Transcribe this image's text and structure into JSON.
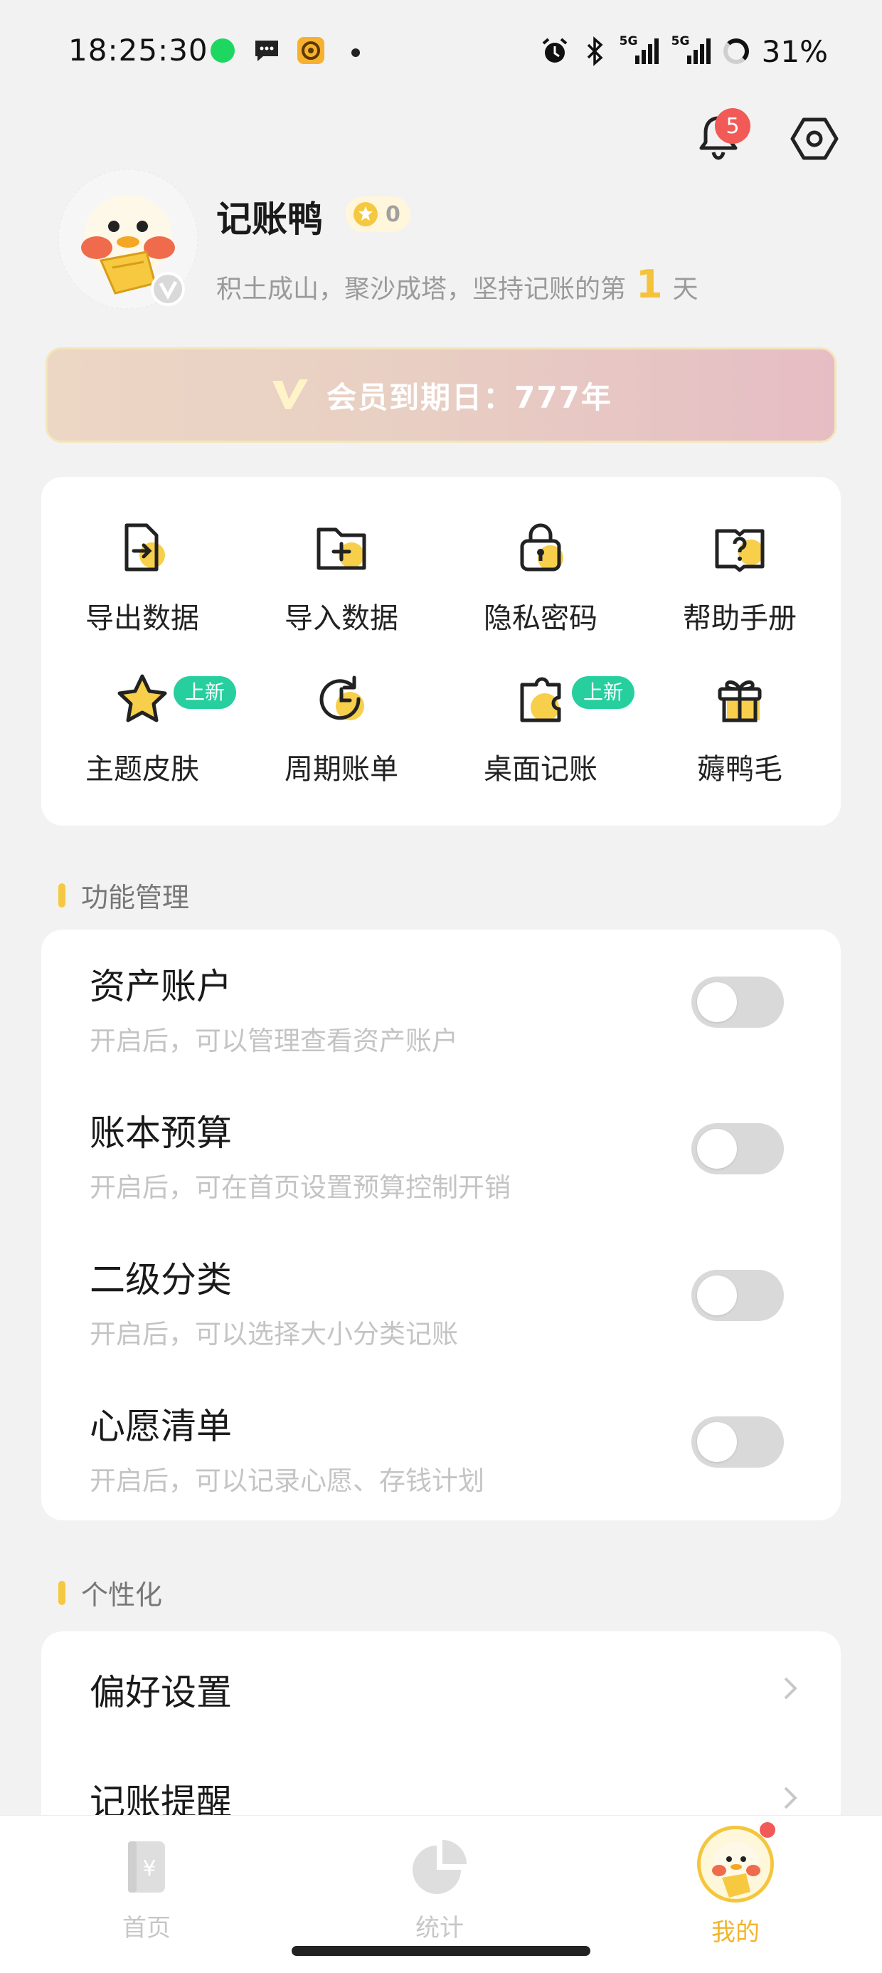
{
  "status_bar": {
    "time": "18:25:30",
    "network1": "5G",
    "network2": "5G",
    "battery": "31%",
    "icons": [
      "spotify-icon",
      "message-icon",
      "app-icon",
      "alarm-icon",
      "bluetooth-icon"
    ]
  },
  "header": {
    "notification_count": "5"
  },
  "profile": {
    "name": "记账鸭",
    "coins": "0",
    "motto_prefix": "积土成山，聚沙成塔，坚持记账的第",
    "days": "1",
    "motto_suffix": "天"
  },
  "vip": {
    "text": "会员到期日：777年"
  },
  "tools": [
    {
      "label": "导出数据",
      "icon": "export-icon",
      "badge": ""
    },
    {
      "label": "导入数据",
      "icon": "import-icon",
      "badge": ""
    },
    {
      "label": "隐私密码",
      "icon": "lock-icon",
      "badge": ""
    },
    {
      "label": "帮助手册",
      "icon": "help-book-icon",
      "badge": ""
    },
    {
      "label": "主题皮肤",
      "icon": "star-icon",
      "badge": "上新"
    },
    {
      "label": "周期账单",
      "icon": "clock-icon",
      "badge": ""
    },
    {
      "label": "桌面记账",
      "icon": "widget-icon",
      "badge": "上新"
    },
    {
      "label": "薅鸭毛",
      "icon": "gift-icon",
      "badge": ""
    }
  ],
  "function_section": {
    "title": "功能管理",
    "items": [
      {
        "title": "资产账户",
        "desc": "开启后，可以管理查看资产账户",
        "enabled": false
      },
      {
        "title": "账本预算",
        "desc": "开启后，可在首页设置预算控制开销",
        "enabled": false
      },
      {
        "title": "二级分类",
        "desc": "开启后，可以选择大小分类记账",
        "enabled": false
      },
      {
        "title": "心愿清单",
        "desc": "开启后，可以记录心愿、存钱计划",
        "enabled": false
      }
    ]
  },
  "personal_section": {
    "title": "个性化",
    "items": [
      {
        "title": "偏好设置"
      },
      {
        "title": "记账提醒"
      }
    ]
  },
  "tabbar": {
    "tabs": [
      {
        "label": "首页",
        "icon": "ledger-icon"
      },
      {
        "label": "统计",
        "icon": "pie-chart-icon"
      },
      {
        "label": "我的",
        "icon": "avatar-icon"
      }
    ],
    "active": "我的"
  },
  "colors": {
    "accent": "#f5c842",
    "badge_new": "#27cf9f",
    "notification": "#f15a56",
    "background": "#f2f2f2"
  }
}
